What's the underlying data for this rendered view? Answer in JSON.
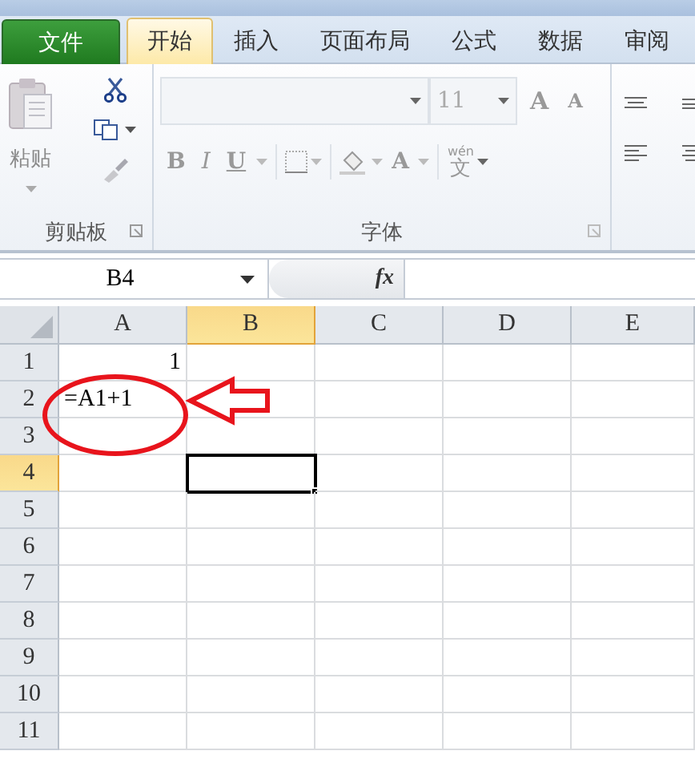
{
  "tabs": [
    {
      "label": "文件",
      "kind": "file",
      "selected": false
    },
    {
      "label": "开始",
      "kind": "tab",
      "selected": true
    },
    {
      "label": "插入",
      "kind": "tab",
      "selected": false
    },
    {
      "label": "页面布局",
      "kind": "tab",
      "selected": false
    },
    {
      "label": "公式",
      "kind": "tab",
      "selected": false
    },
    {
      "label": "数据",
      "kind": "tab",
      "selected": false
    },
    {
      "label": "审阅",
      "kind": "tab",
      "selected": false
    }
  ],
  "ribbon": {
    "clipboard": {
      "title": "剪贴板",
      "paste_label": "粘贴"
    },
    "font": {
      "title": "字体",
      "font_size": "11",
      "grow_label": "A",
      "shrink_label": "A",
      "bold_label": "B",
      "italic_label": "I",
      "underline_label": "U",
      "color_label": "A",
      "phonetic_ruby": "wén",
      "phonetic_char": "文"
    }
  },
  "name_box": "B4",
  "formula_label": "fx",
  "columns": [
    {
      "label": "A",
      "selected": false
    },
    {
      "label": "B",
      "selected": true
    },
    {
      "label": "C",
      "selected": false
    },
    {
      "label": "D",
      "selected": false
    },
    {
      "label": "E",
      "selected": false
    }
  ],
  "rows": [
    {
      "label": "1",
      "selected": false,
      "cells": [
        {
          "value": "1",
          "kind": "number"
        }
      ]
    },
    {
      "label": "2",
      "selected": false,
      "cells": [
        {
          "value": "=A1+1",
          "kind": "text"
        }
      ]
    },
    {
      "label": "3",
      "selected": false,
      "cells": []
    },
    {
      "label": "4",
      "selected": true,
      "cells": [
        {
          "kind": "empty",
          "active": false
        },
        {
          "kind": "empty",
          "active": true
        }
      ]
    },
    {
      "label": "5",
      "selected": false,
      "cells": []
    },
    {
      "label": "6",
      "selected": false,
      "cells": []
    },
    {
      "label": "7",
      "selected": false,
      "cells": []
    },
    {
      "label": "8",
      "selected": false,
      "cells": []
    },
    {
      "label": "9",
      "selected": false,
      "cells": []
    },
    {
      "label": "10",
      "selected": false,
      "cells": []
    },
    {
      "label": "11",
      "selected": false,
      "cells": []
    }
  ],
  "callout": {
    "color": "#e8141c"
  }
}
